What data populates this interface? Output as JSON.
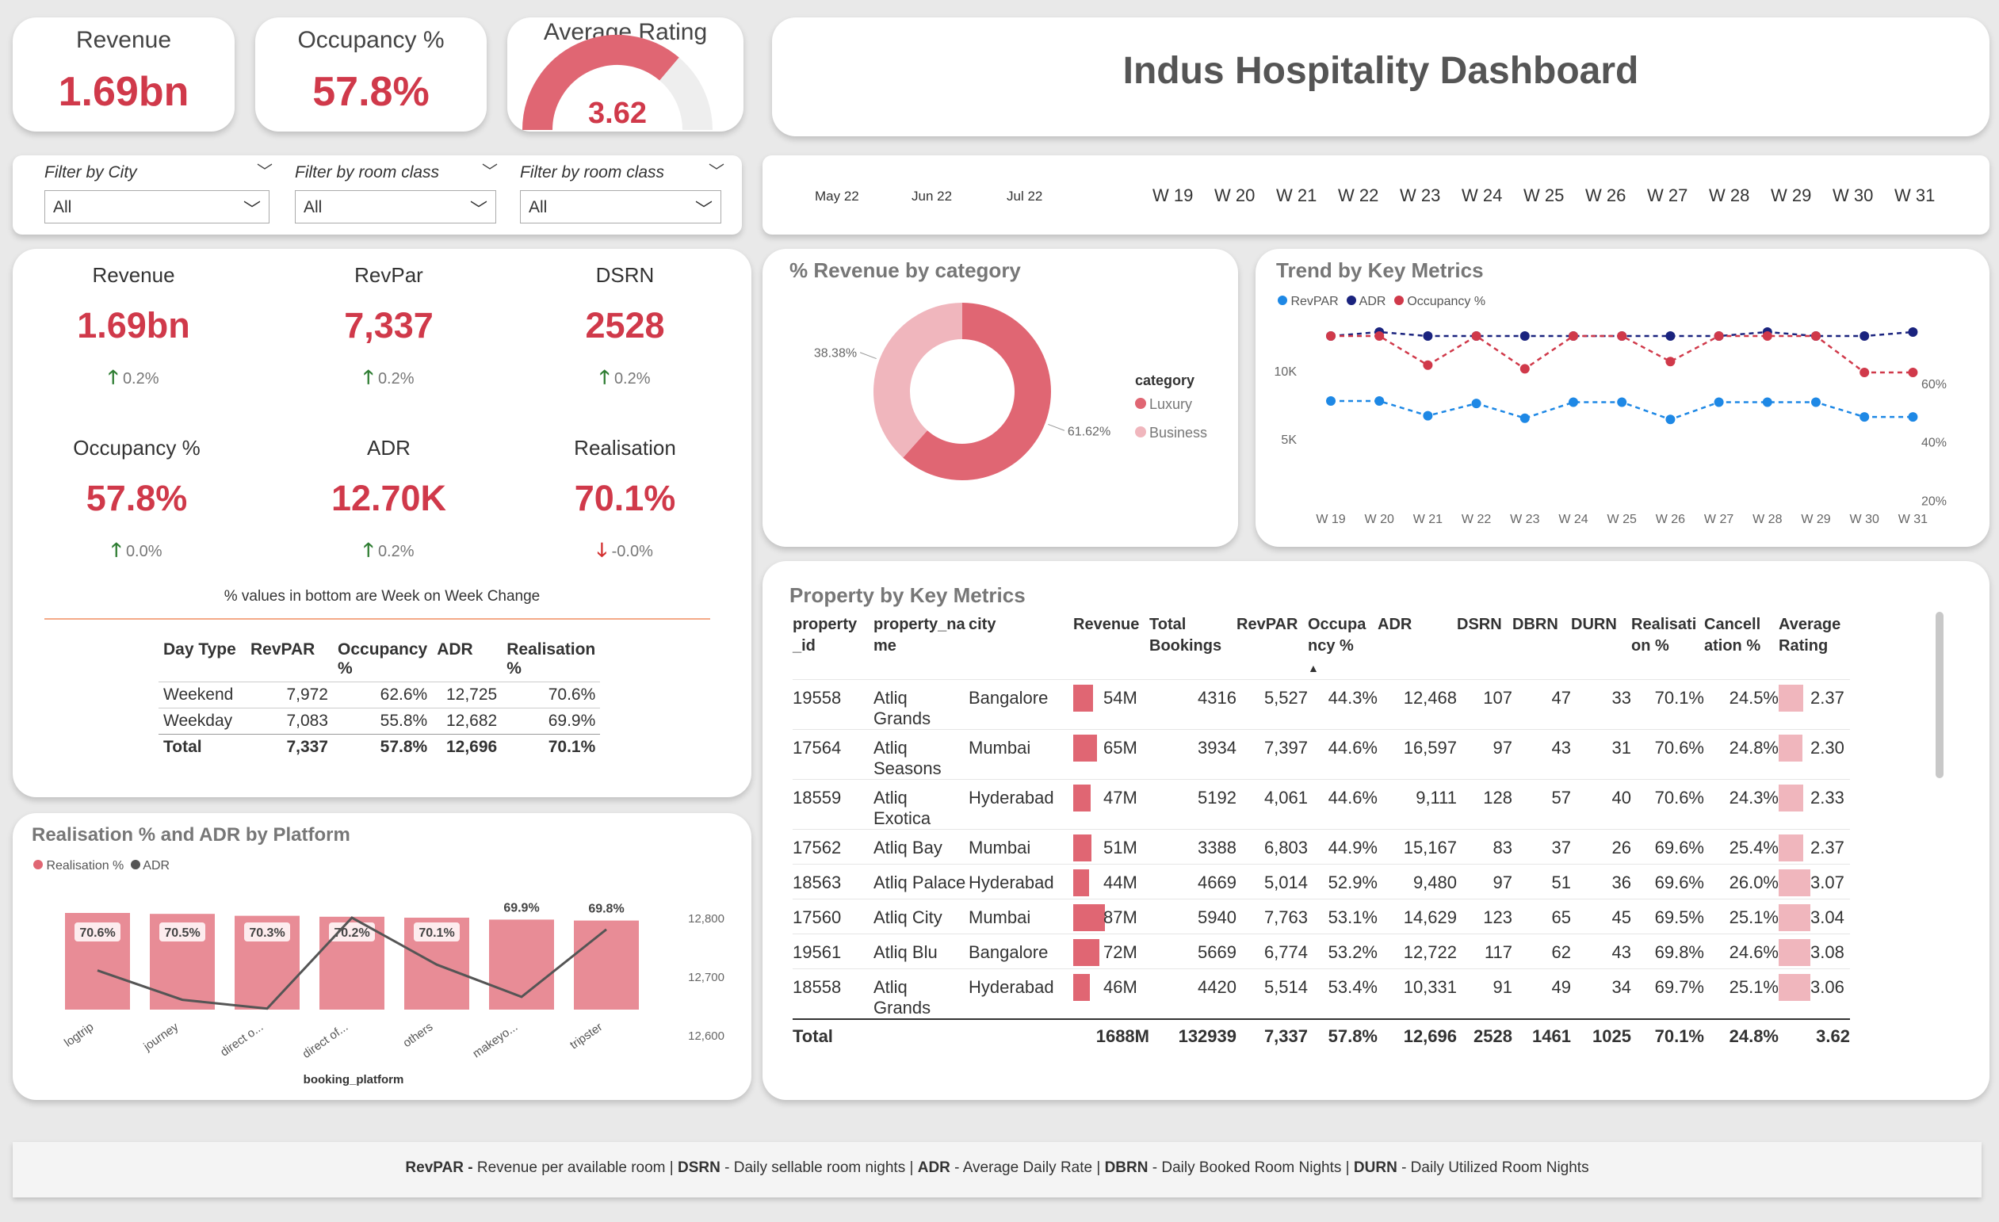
{
  "kpi_top": {
    "revenue": {
      "title": "Revenue",
      "value": "1.69bn"
    },
    "occupancy": {
      "title": "Occupancy %",
      "value": "57.8%"
    },
    "rating": {
      "title": "Average Rating",
      "value": "3.62",
      "fraction": 0.724
    }
  },
  "dashboard_title": "Indus Hospitality Dashboard",
  "filters": [
    {
      "label": "Filter by City",
      "value": "All"
    },
    {
      "label": "Filter by room class",
      "value": "All"
    },
    {
      "label": "Filter by room class",
      "value": "All"
    }
  ],
  "timeline": {
    "months": [
      "May 22",
      "Jun 22",
      "Jul 22"
    ],
    "weeks": [
      "W 19",
      "W 20",
      "W 21",
      "W 22",
      "W 23",
      "W 24",
      "W 25",
      "W 26",
      "W 27",
      "W 28",
      "W 29",
      "W 30",
      "W 31"
    ]
  },
  "kpi_grid": [
    {
      "title": "Revenue",
      "value": "1.69bn",
      "change": "0.2%",
      "dir": "up"
    },
    {
      "title": "RevPar",
      "value": "7,337",
      "change": "0.2%",
      "dir": "up"
    },
    {
      "title": "DSRN",
      "value": "2528",
      "change": "0.2%",
      "dir": "up"
    },
    {
      "title": "Occupancy %",
      "value": "57.8%",
      "change": "0.0%",
      "dir": "up"
    },
    {
      "title": "ADR",
      "value": "12.70K",
      "change": "0.2%",
      "dir": "up"
    },
    {
      "title": "Realisation",
      "value": "70.1%",
      "change": "-0.0%",
      "dir": "down"
    }
  ],
  "wow_note": "% values in bottom are Week on Week Change",
  "day_type_table": {
    "headers": [
      "Day Type",
      "RevPAR",
      "Occupancy %",
      "ADR",
      "Realisation %"
    ],
    "rows": [
      [
        "Weekend",
        "7,972",
        "62.6%",
        "12,725",
        "70.6%"
      ],
      [
        "Weekday",
        "7,083",
        "55.8%",
        "12,682",
        "69.9%"
      ]
    ],
    "total": [
      "Total",
      "7,337",
      "57.8%",
      "12,696",
      "70.1%"
    ]
  },
  "donut": {
    "title": "% Revenue by category",
    "legend_title": "category",
    "slices": [
      {
        "name": "Luxury",
        "pct": 61.62,
        "label": "61.62%",
        "color": "#e06673"
      },
      {
        "name": "Business",
        "pct": 38.38,
        "label": "38.38%",
        "color": "#f0b6bd"
      }
    ]
  },
  "trend": {
    "title": "Trend by Key Metrics",
    "legend": [
      "RevPAR",
      "ADR",
      "Occupancy %"
    ],
    "colors": {
      "RevPAR": "#1e88e5",
      "ADR": "#1a237e",
      "Occupancy %": "#d0394a"
    },
    "y_left_ticks": [
      "10K",
      "5K"
    ],
    "y_right_ticks": [
      "60%",
      "40%",
      "20%",
      "0%"
    ]
  },
  "platform_chart": {
    "title": "Realisation % and ADR by Platform",
    "legend": [
      "Realisation %",
      "ADR"
    ],
    "xlabel": "booking_platform",
    "y2_ticks": [
      "12,800",
      "12,700",
      "12,600"
    ]
  },
  "property_table": {
    "title": "Property by Key Metrics",
    "headers": [
      "property_id",
      "property_name",
      "city",
      "Revenue",
      "Total Bookings",
      "RevPAR",
      "Occupancy %",
      "ADR",
      "DSRN",
      "DBRN",
      "DURN",
      "Realisation %",
      "Cancellation %",
      "Average Rating"
    ],
    "rows": [
      [
        "19558",
        "Atliq Grands",
        "Bangalore",
        "54M",
        "4316",
        "5,527",
        "44.3%",
        "12,468",
        "107",
        "47",
        "33",
        "70.1%",
        "24.5%",
        "2.37"
      ],
      [
        "17564",
        "Atliq Seasons",
        "Mumbai",
        "65M",
        "3934",
        "7,397",
        "44.6%",
        "16,597",
        "97",
        "43",
        "31",
        "70.6%",
        "24.8%",
        "2.30"
      ],
      [
        "18559",
        "Atliq Exotica",
        "Hyderabad",
        "47M",
        "5192",
        "4,061",
        "44.6%",
        "9,111",
        "128",
        "57",
        "40",
        "70.6%",
        "24.3%",
        "2.33"
      ],
      [
        "17562",
        "Atliq Bay",
        "Mumbai",
        "51M",
        "3388",
        "6,803",
        "44.9%",
        "15,167",
        "83",
        "37",
        "26",
        "69.6%",
        "25.4%",
        "2.37"
      ],
      [
        "18563",
        "Atliq Palace",
        "Hyderabad",
        "44M",
        "4669",
        "5,014",
        "52.9%",
        "9,480",
        "97",
        "51",
        "36",
        "69.6%",
        "26.0%",
        "3.07"
      ],
      [
        "17560",
        "Atliq City",
        "Mumbai",
        "87M",
        "5940",
        "7,763",
        "53.1%",
        "14,629",
        "123",
        "65",
        "45",
        "69.5%",
        "25.1%",
        "3.04"
      ],
      [
        "19561",
        "Atliq Blu",
        "Bangalore",
        "72M",
        "5669",
        "6,774",
        "53.2%",
        "12,722",
        "117",
        "62",
        "43",
        "69.8%",
        "24.6%",
        "3.08"
      ],
      [
        "18558",
        "Atliq Grands",
        "Hyderabad",
        "46M",
        "4420",
        "5,514",
        "53.4%",
        "10,331",
        "91",
        "49",
        "34",
        "69.7%",
        "25.1%",
        "3.06"
      ]
    ],
    "total": [
      "Total",
      "",
      "",
      "1688M",
      "132939",
      "7,337",
      "57.8%",
      "12,696",
      "2528",
      "1461",
      "1025",
      "70.1%",
      "24.8%",
      "3.62"
    ]
  },
  "chart_data": [
    {
      "type": "line",
      "title": "Trend by Key Metrics",
      "x": [
        "W 19",
        "W 20",
        "W 21",
        "W 22",
        "W 23",
        "W 24",
        "W 25",
        "W 26",
        "W 27",
        "W 28",
        "W 29",
        "W 30",
        "W 31"
      ],
      "series": [
        {
          "name": "RevPAR",
          "values": [
            7800,
            7800,
            6600,
            7600,
            6400,
            7700,
            7700,
            6300,
            7700,
            7700,
            7700,
            6500,
            6500
          ]
        },
        {
          "name": "ADR",
          "values": [
            12700,
            12750,
            12700,
            12700,
            12700,
            12700,
            12700,
            12700,
            12700,
            12750,
            12700,
            12700,
            12750
          ]
        },
        {
          "name": "Occupancy %",
          "values": [
            60,
            60,
            52,
            60,
            51,
            60,
            60,
            53,
            60,
            60,
            60,
            50,
            50
          ]
        }
      ],
      "y_left_ticks": [
        5000,
        10000
      ],
      "y_right_ticks": [
        0,
        20,
        40,
        60
      ]
    },
    {
      "type": "bar",
      "title": "Realisation % and ADR by Platform",
      "categories": [
        "logtrip",
        "journey",
        "direct o...",
        "direct of...",
        "others",
        "makeyo...",
        "tripster"
      ],
      "series": [
        {
          "name": "Realisation %",
          "values": [
            70.6,
            70.5,
            70.3,
            70.2,
            70.1,
            69.9,
            69.8
          ],
          "labels": [
            "70.6%",
            "70.5%",
            "70.3%",
            "70.2%",
            "70.1%",
            "69.9%",
            "69.8%"
          ]
        },
        {
          "name": "ADR",
          "values": [
            12710,
            12660,
            12645,
            12800,
            12720,
            12665,
            12780
          ]
        }
      ],
      "xlabel": "booking_platform",
      "y2_ticks": [
        12600,
        12700,
        12800
      ]
    },
    {
      "type": "pie",
      "title": "% Revenue by category",
      "categories": [
        "Luxury",
        "Business"
      ],
      "values": [
        61.62,
        38.38
      ]
    }
  ]
}
